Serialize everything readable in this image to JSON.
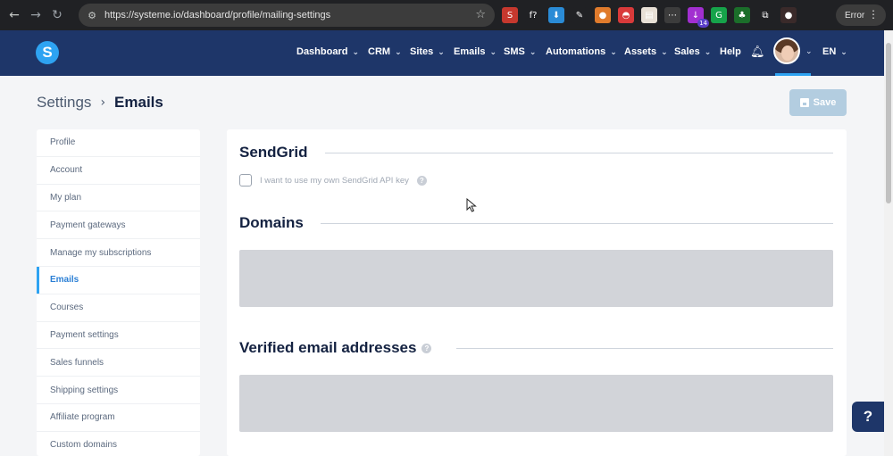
{
  "browser": {
    "url": "https://systeme.io/dashboard/profile/mailing-settings",
    "error_label": "Error",
    "extensions": [
      {
        "name": "ext-red-icon",
        "color": "#c6382e",
        "glyph": "S"
      },
      {
        "name": "ext-font-icon",
        "color": "#202124",
        "glyph": "f?"
      },
      {
        "name": "ext-download-icon",
        "color": "#2a8bd6",
        "glyph": "⬇"
      },
      {
        "name": "ext-eyedropper-icon",
        "color": "#202124",
        "glyph": "✎"
      },
      {
        "name": "ext-orange-icon",
        "color": "#e07b2c",
        "glyph": "●"
      },
      {
        "name": "ext-pokeball-icon",
        "color": "#d93a3a",
        "glyph": "◓"
      },
      {
        "name": "ext-white-icon",
        "color": "#e8e0d6",
        "glyph": "▤"
      },
      {
        "name": "ext-dots-icon",
        "color": "#3c3c3c",
        "glyph": "⋯"
      },
      {
        "name": "ext-purple-icon",
        "color": "#a22fd0",
        "glyph": "↓",
        "badge": "14"
      },
      {
        "name": "ext-grammarly-icon",
        "color": "#16a34a",
        "glyph": "G"
      },
      {
        "name": "ext-green-icon",
        "color": "#1b6e2a",
        "glyph": "♣"
      },
      {
        "name": "ext-puzzle-icon",
        "color": "#202124",
        "glyph": "⧉"
      },
      {
        "name": "ext-profile-icon",
        "color": "#3a2a2a",
        "glyph": "●"
      }
    ]
  },
  "header": {
    "menu": [
      {
        "label": "Dashboard",
        "dropdown": true
      },
      {
        "label": "CRM",
        "dropdown": true
      },
      {
        "label": "Sites",
        "dropdown": true
      },
      {
        "label": "Emails",
        "dropdown": true
      },
      {
        "label": "SMS",
        "dropdown": true
      },
      {
        "label": "Automations",
        "dropdown": true
      },
      {
        "label": "Assets",
        "dropdown": true
      },
      {
        "label": "Sales",
        "dropdown": true
      },
      {
        "label": "Help",
        "dropdown": false
      }
    ],
    "language": "EN"
  },
  "page": {
    "breadcrumb_parent": "Settings",
    "breadcrumb_current": "Emails",
    "save_label": "Save"
  },
  "sidebar": {
    "items": [
      {
        "label": "Profile",
        "active": false
      },
      {
        "label": "Account",
        "active": false
      },
      {
        "label": "My plan",
        "active": false
      },
      {
        "label": "Payment gateways",
        "active": false
      },
      {
        "label": "Manage my subscriptions",
        "active": false
      },
      {
        "label": "Emails",
        "active": true
      },
      {
        "label": "Courses",
        "active": false
      },
      {
        "label": "Payment settings",
        "active": false
      },
      {
        "label": "Sales funnels",
        "active": false
      },
      {
        "label": "Shipping settings",
        "active": false
      },
      {
        "label": "Affiliate program",
        "active": false
      },
      {
        "label": "Custom domains",
        "active": false
      }
    ]
  },
  "main": {
    "sendgrid_title": "SendGrid",
    "sendgrid_checkbox_label": "I want to use my own SendGrid API key",
    "domains_title": "Domains",
    "verified_title": "Verified email addresses"
  },
  "help_fab": "?"
}
